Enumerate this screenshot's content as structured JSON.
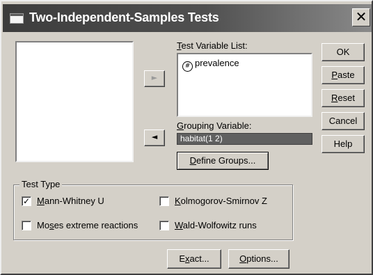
{
  "window": {
    "title": "Two-Independent-Samples Tests",
    "close_glyph": "✕"
  },
  "test_variable_list": {
    "label_prefix": "",
    "label_underline": "T",
    "label_rest": "est Variable List:",
    "items": [
      {
        "icon": "scale-variable-icon",
        "glyph": "#",
        "name": "prevalence"
      }
    ]
  },
  "grouping_variable": {
    "label_underline": "G",
    "label_rest": "rouping Variable:",
    "value": "habitat(1 2)"
  },
  "define_groups_button": {
    "pre": "",
    "underline": "D",
    "rest": "efine Groups..."
  },
  "arrows": {
    "move_to_test_list": "►",
    "move_to_grouping": "◄"
  },
  "buttons": {
    "ok": {
      "pre": "OK",
      "underline": "",
      "rest": ""
    },
    "paste": {
      "pre": "",
      "underline": "P",
      "rest": "aste"
    },
    "reset": {
      "pre": "",
      "underline": "R",
      "rest": "eset"
    },
    "cancel": {
      "pre": "Cancel",
      "underline": "",
      "rest": ""
    },
    "help": {
      "pre": "Help",
      "underline": "",
      "rest": ""
    }
  },
  "test_type": {
    "title": "Test Type",
    "options": [
      {
        "pre": "",
        "underline": "M",
        "rest": "ann-Whitney U",
        "checked": true
      },
      {
        "pre": "",
        "underline": "K",
        "rest": "olmogorov-Smirnov Z",
        "checked": false
      },
      {
        "pre": "Mo",
        "underline": "s",
        "rest": "es extreme reactions",
        "checked": false
      },
      {
        "pre": "",
        "underline": "W",
        "rest": "ald-Wolfowitz runs",
        "checked": false
      }
    ]
  },
  "bottom_buttons": {
    "exact": {
      "pre": "E",
      "underline": "x",
      "rest": "act..."
    },
    "options": {
      "pre": "",
      "underline": "O",
      "rest": "ptions..."
    }
  },
  "check_glyph": "✓",
  "colors": {
    "face": "#d4d0c8",
    "titlebar": "#404040",
    "selection": "#606060"
  }
}
